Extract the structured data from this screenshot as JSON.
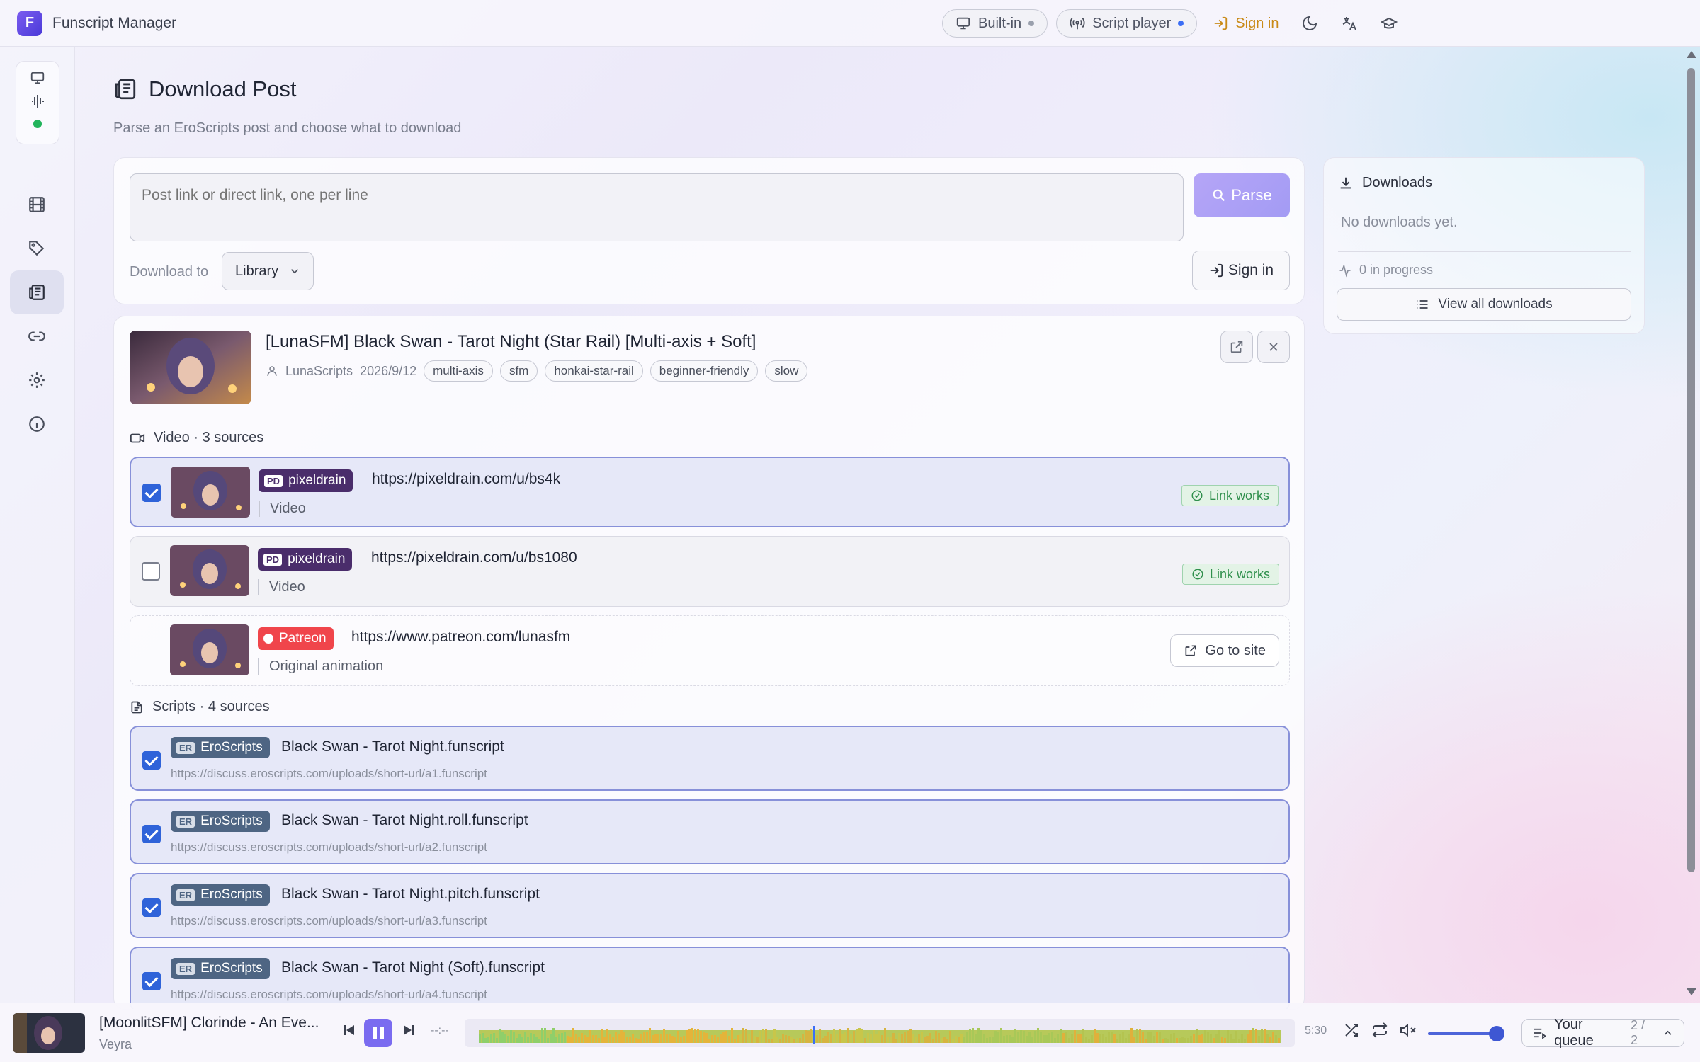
{
  "app": {
    "title": "Funscript Manager"
  },
  "topbar": {
    "builtin_label": "Built-in",
    "script_player_label": "Script player",
    "signin_label": "Sign in",
    "accent_color": "#c98a17"
  },
  "page": {
    "title": "Download Post",
    "subtitle": "Parse an EroScripts post and choose what to download"
  },
  "parse": {
    "input_placeholder": "Post link or direct link, one per line",
    "parse_label": "Parse",
    "download_to_label": "Download to",
    "download_to_value": "Library",
    "signin_label": "Sign in"
  },
  "downloads": {
    "title": "Downloads",
    "empty_text": "No downloads yet.",
    "in_progress": "0 in progress",
    "view_all_label": "View all downloads"
  },
  "post": {
    "title": "[LunaSFM] Black Swan - Tarot Night (Star Rail) [Multi-axis + Soft]",
    "author": "LunaScripts",
    "date": "2026/9/12",
    "tags": [
      "multi-axis",
      "sfm",
      "honkai-star-rail",
      "beginner-friendly",
      "slow"
    ]
  },
  "video_section": {
    "heading": "Video · 3 sources",
    "sources": [
      {
        "host": "pixeldrain",
        "host_mark": "PD",
        "url": "https://pixeldrain.com/u/bs4k",
        "sub": "Video",
        "checked": true,
        "status": "Link works"
      },
      {
        "host": "pixeldrain",
        "host_mark": "PD",
        "url": "https://pixeldrain.com/u/bs1080",
        "sub": "Video",
        "checked": false,
        "status": "Link works"
      },
      {
        "host": "Patreon",
        "url": "https://www.patreon.com/lunasfm",
        "sub": "Original animation",
        "action": "Go to site"
      }
    ]
  },
  "scripts_section": {
    "heading": "Scripts · 4 sources",
    "host": "EroScripts",
    "host_mark": "ER",
    "scripts": [
      {
        "name": "Black Swan - Tarot Night.funscript",
        "url": "https://discuss.eroscripts.com/uploads/short-url/a1.funscript",
        "checked": true
      },
      {
        "name": "Black Swan - Tarot Night.roll.funscript",
        "url": "https://discuss.eroscripts.com/uploads/short-url/a2.funscript",
        "checked": true
      },
      {
        "name": "Black Swan - Tarot Night.pitch.funscript",
        "url": "https://discuss.eroscripts.com/uploads/short-url/a3.funscript",
        "checked": true
      },
      {
        "name": "Black Swan - Tarot Night (Soft).funscript",
        "url": "https://discuss.eroscripts.com/uploads/short-url/a4.funscript",
        "checked": true
      }
    ]
  },
  "player": {
    "title": "[MoonlitSFM] Clorinde - An Eve...",
    "artist": "Veyra",
    "elapsed": "--:--",
    "duration": "5:30",
    "queue_label": "Your queue",
    "queue_count": "2 / 2",
    "volume_fraction": 0.9
  },
  "colors": {
    "accent": "#7a6bf0",
    "pixeldrain": "#4a2d6b",
    "patreon": "#f0454b",
    "eroscripts": "#4e6583",
    "link_works": "#2f8f4c"
  }
}
